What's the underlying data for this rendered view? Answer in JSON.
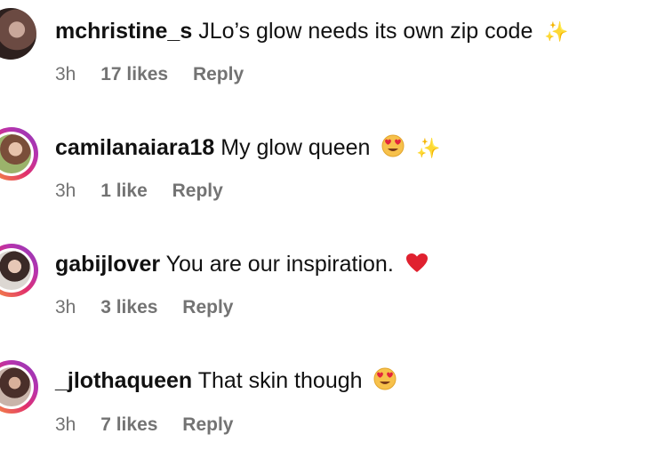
{
  "comments": [
    {
      "username": "mchristine_s",
      "text": "JLo’s glow needs its own zip code",
      "emoji": [
        "sparkles-icon"
      ],
      "time": "3h",
      "likes": "17 likes",
      "reply": "Reply"
    },
    {
      "username": "camilanaiara18",
      "text": "My glow queen",
      "emoji": [
        "heart-eyes-icon",
        "sparkles-icon"
      ],
      "time": "3h",
      "likes": "1 like",
      "reply": "Reply"
    },
    {
      "username": "gabijlover",
      "text": "You are our inspiration.",
      "emoji": [
        "red-heart-icon"
      ],
      "time": "3h",
      "likes": "3 likes",
      "reply": "Reply"
    },
    {
      "username": "_jlothaqueen",
      "text": "That skin though",
      "emoji": [
        "heart-eyes-icon"
      ],
      "time": "3h",
      "likes": "7 likes",
      "reply": "Reply"
    }
  ],
  "colors": {
    "text": "#111111",
    "meta": "#737373",
    "story_ring": "#e1306c"
  }
}
